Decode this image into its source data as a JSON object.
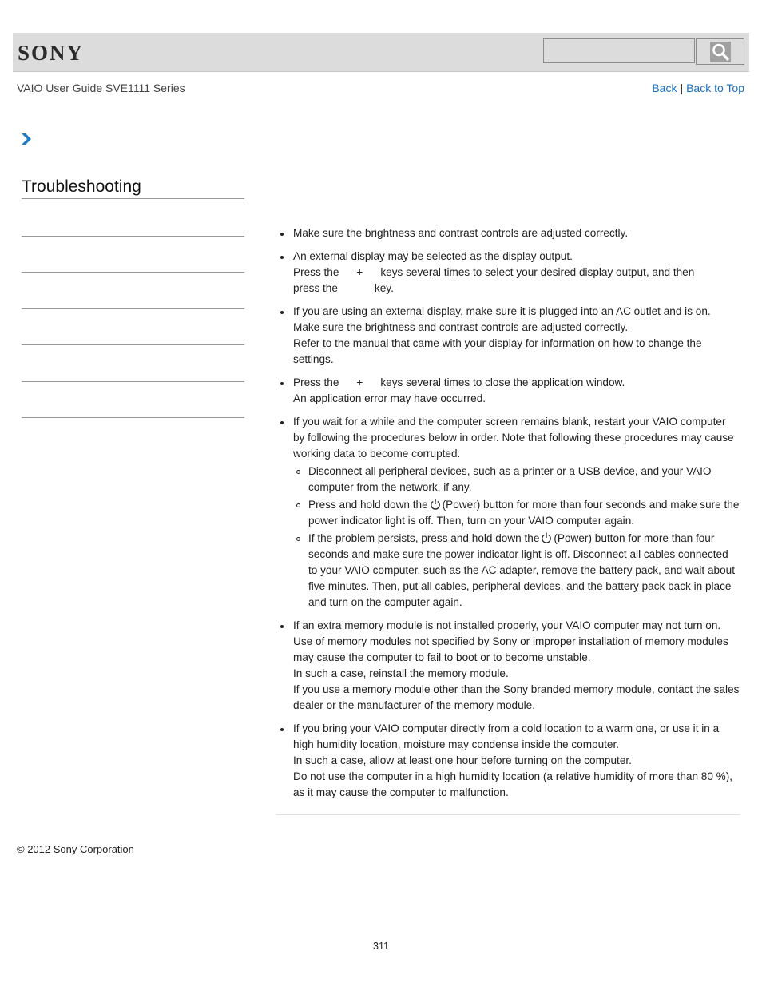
{
  "header": {
    "logo": "SONY",
    "search_placeholder": "",
    "search_value": "",
    "search_icon": "search-icon"
  },
  "nav": {
    "guide_title": "VAIO User Guide SVE1111 Series",
    "back_label": "Back",
    "separator": "|",
    "back_to_top_label": "Back to Top",
    "breadcrumb_icon": "chevron-right-icon"
  },
  "sidebar": {
    "section_title": "Troubleshooting",
    "items": [
      {
        "label": ""
      },
      {
        "label": ""
      },
      {
        "label": ""
      },
      {
        "label": ""
      },
      {
        "label": ""
      }
    ]
  },
  "content": {
    "items": [
      {
        "lines": [
          "Make sure the brightness and contrast controls are adjusted correctly."
        ]
      },
      {
        "line1": "An external display may be selected as the display output.",
        "line2a": "Press the",
        "plus": "+",
        "line2b": "keys several times to select your desired display output, and then",
        "line3a": "press the",
        "line3b": "key."
      },
      {
        "p1": "If you are using an external display, make sure it is plugged into an AC outlet and is on.",
        "p2": "Make sure the brightness and contrast controls are adjusted correctly.",
        "p3": "Refer to the manual that came with your display for information on how to change the settings."
      },
      {
        "line1a": "Press the",
        "plus": "+",
        "line1b": "keys several times to close the application window.",
        "line2": "An application error may have occurred."
      },
      {
        "intro": "If you wait for a while and the computer screen remains blank, restart your VAIO computer by following the procedures below in order. Note that following these procedures may cause working data to become corrupted.",
        "sub": [
          {
            "text": "Disconnect all peripheral devices, such as a printer or a USB device, and your VAIO computer from the network, if any."
          },
          {
            "before": "Press and hold down the",
            "after": "(Power) button for more than four seconds and make sure the power indicator light is off. Then, turn on your VAIO computer again."
          },
          {
            "before": "If the problem persists, press and hold down the",
            "after": "(Power) button for more than four seconds and make sure the power indicator light is off. Disconnect all cables connected to your VAIO computer, such as the AC adapter, remove the battery pack, and wait about five minutes. Then, put all cables, peripheral devices, and the battery pack back in place and turn on the computer again."
          }
        ]
      },
      {
        "p1": "If an extra memory module is not installed properly, your VAIO computer may not turn on.",
        "p2": "Use of memory modules not specified by Sony or improper installation of memory modules may cause the computer to fail to boot or to become unstable.",
        "p3": "In such a case, reinstall the memory module.",
        "p4": "If you use a memory module other than the Sony branded memory module, contact the sales dealer or the manufacturer of the memory module."
      },
      {
        "p1": "If you bring your VAIO computer directly from a cold location to a warm one, or use it in a high humidity location, moisture may condense inside the computer.",
        "p2": "In such a case, allow at least one hour before turning on the computer.",
        "p3": "Do not use the computer in a high humidity location (a relative humidity of more than 80 %), as it may cause the computer to malfunction."
      }
    ]
  },
  "footer": {
    "copyright": "© 2012 Sony Corporation",
    "page_number": "311"
  },
  "colors": {
    "link": "#1a70c0",
    "header_bg": "#dcdcdc",
    "chevron": "#1f7cc4"
  }
}
